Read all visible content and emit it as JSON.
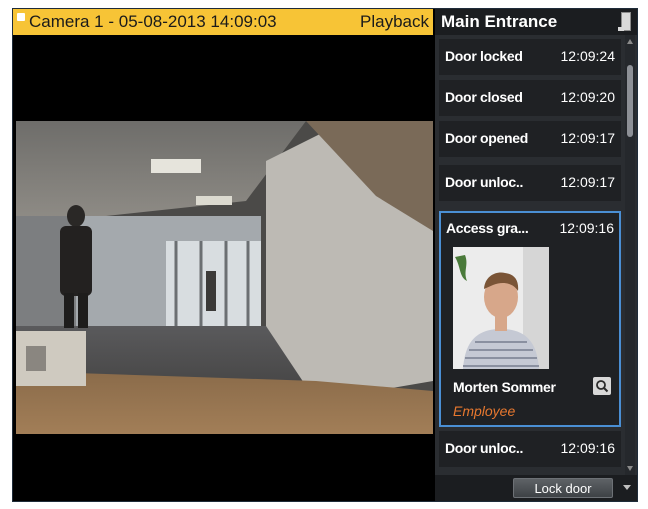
{
  "camera": {
    "title": "Camera 1 - 05-08-2013 14:09:03",
    "mode": "Playback",
    "header_color": "#f7c436"
  },
  "events_panel": {
    "title": "Main Entrance",
    "items": [
      {
        "name": "Door locked",
        "time": "12:09:24"
      },
      {
        "name": "Door closed",
        "time": "12:09:20"
      },
      {
        "name": "Door opened",
        "time": "12:09:17"
      },
      {
        "name": "Door unloc..",
        "time": "12:09:17"
      }
    ],
    "selected": {
      "name": "Access gra...",
      "time": "12:09:16",
      "person_name": "Morten Sommer",
      "person_role": "Employee",
      "role_color": "#e7782f"
    },
    "after_items": [
      {
        "name": "Door unloc..",
        "time": "12:09:16"
      }
    ],
    "selection_color": "#4a8fd4"
  },
  "footer": {
    "lock_label": "Lock door"
  },
  "icons": [
    "device-icon",
    "search-icon",
    "chevron-down-icon"
  ]
}
